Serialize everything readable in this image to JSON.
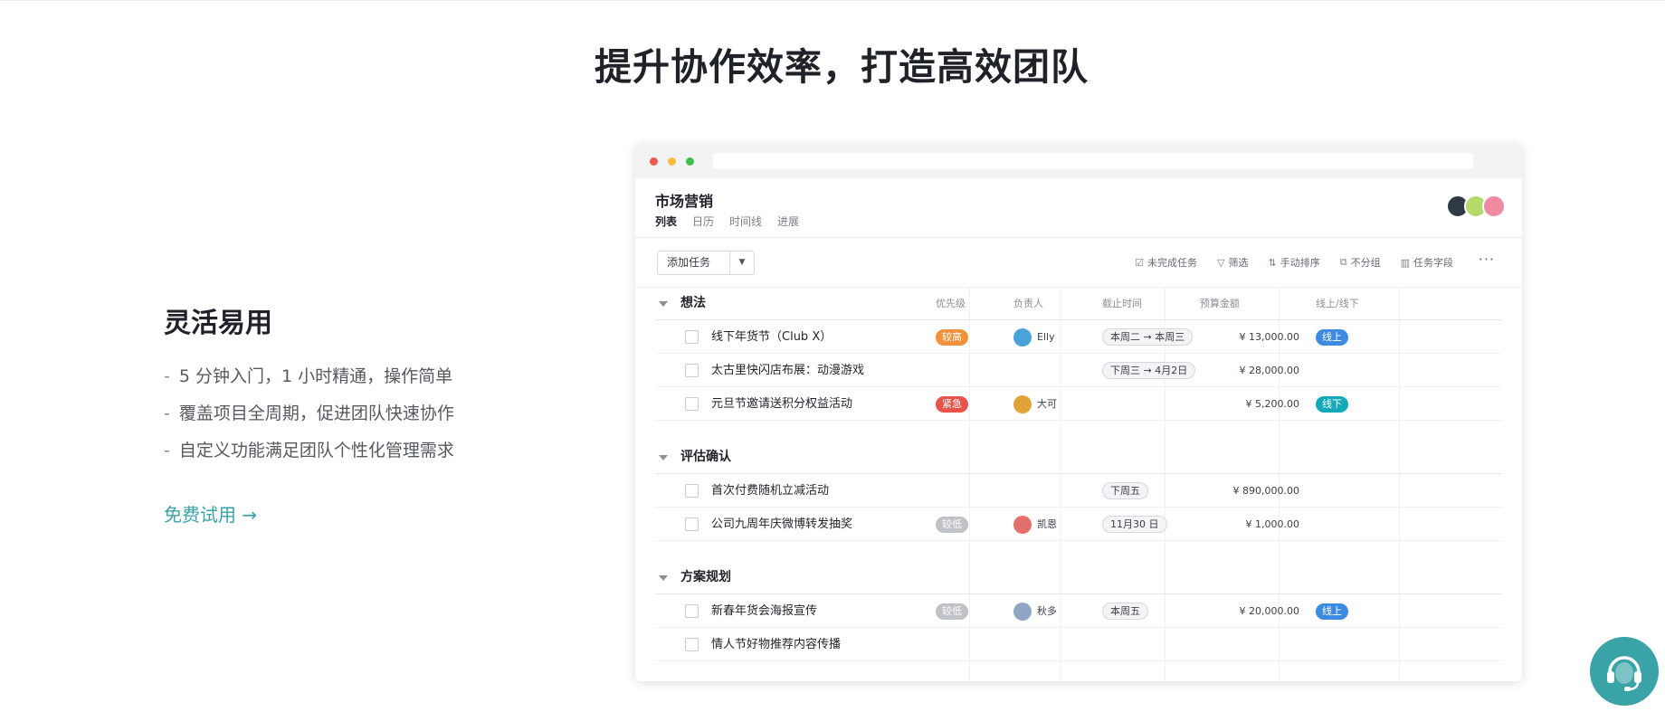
{
  "headline": "提升协作效率，打造高效团队",
  "feature": {
    "title": "灵活易用",
    "bullets": [
      "5 分钟入门，1 小时精通，操作简单",
      "覆盖项目全周期，促进团队快速协作",
      "自定义功能满足团队个性化管理需求"
    ],
    "dash": "-",
    "cta": "免费试用 →"
  },
  "app": {
    "project_title": "市场营销",
    "tabs": [
      "列表",
      "日历",
      "时间线",
      "进展"
    ],
    "add_task": "添加任务",
    "toolbar": [
      {
        "icon": "check-square-icon",
        "label": "未完成任务"
      },
      {
        "icon": "filter-icon",
        "label": "筛选"
      },
      {
        "icon": "sort-icon",
        "label": "手动排序"
      },
      {
        "icon": "group-icon",
        "label": "不分组"
      },
      {
        "icon": "columns-icon",
        "label": "任务字段"
      }
    ],
    "more": "···",
    "columns": [
      "优先级",
      "负责人",
      "截止时间",
      "预算金额",
      "线上/线下"
    ],
    "groups": [
      {
        "name": "想法",
        "tasks": [
          {
            "name": "线下年货节（Club X）",
            "priority": "较高",
            "priority_color": "#f0923c",
            "owner": "Elly",
            "owner_color": "#4aa3d8",
            "due": "本周二 → 本周三",
            "budget": "¥ 13,000.00",
            "channel": "线上",
            "channel_color": "#3c8be0"
          },
          {
            "name": "太古里快闪店布展：动漫游戏",
            "priority": "",
            "owner": "",
            "due": "下周三 → 4月2日",
            "budget": "¥ 28,000.00",
            "channel": ""
          },
          {
            "name": "元旦节邀请送积分权益活动",
            "priority": "紧急",
            "priority_color": "#e8544c",
            "owner": "大可",
            "owner_color": "#e0a23a",
            "due": "",
            "budget": "¥ 5,200.00",
            "channel": "线下",
            "channel_color": "#14a9b8"
          }
        ]
      },
      {
        "name": "评估确认",
        "tasks": [
          {
            "name": "首次付费随机立减活动",
            "priority": "",
            "owner": "",
            "due": "下周五",
            "budget": "¥ 890,000.00",
            "channel": ""
          },
          {
            "name": "公司九周年庆微博转发抽奖",
            "priority": "较低",
            "priority_color": "#bfc2c6",
            "owner": "凯恩",
            "owner_color": "#e36f6f",
            "due": "11月30 日",
            "budget": "¥ 1,000.00",
            "channel": ""
          }
        ]
      },
      {
        "name": "方案规划",
        "tasks": [
          {
            "name": "新春年货会海报宣传",
            "priority": "较低",
            "priority_color": "#bfc2c6",
            "owner": "秋多",
            "owner_color": "#8fa7c4",
            "due": "本周五",
            "budget": "¥ 20,000.00",
            "channel": "线上",
            "channel_color": "#3c8be0"
          },
          {
            "name": "情人节好物推荐内容传播",
            "priority": "",
            "owner": "",
            "due": "",
            "budget": "",
            "channel": ""
          }
        ]
      }
    ]
  },
  "colors": {
    "accent": "#3aa3a8"
  }
}
